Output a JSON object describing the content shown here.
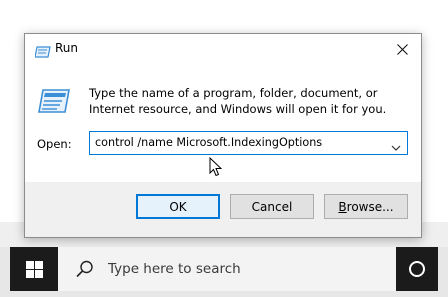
{
  "window": {
    "title": "Run",
    "close_glyph": "✕"
  },
  "dialog": {
    "description": "Type the name of a program, folder, document, or Internet resource, and Windows will open it for you.",
    "open_label": "Open:",
    "open_value": "control /name Microsoft.IndexingOptions",
    "buttons": {
      "ok": "OK",
      "cancel": "Cancel",
      "browse_underlined": "B",
      "browse_rest": "rowse..."
    }
  },
  "taskbar": {
    "search_placeholder": "Type here to search"
  },
  "colors": {
    "accent": "#0078d7",
    "taskbar": "#1b1b1b",
    "icon_blue": "#3b8fd6"
  },
  "icons": [
    "run-icon",
    "close-icon",
    "chevron-down-icon",
    "windows-logo-icon",
    "search-icon",
    "cortana-icon",
    "mouse-cursor-icon"
  ]
}
